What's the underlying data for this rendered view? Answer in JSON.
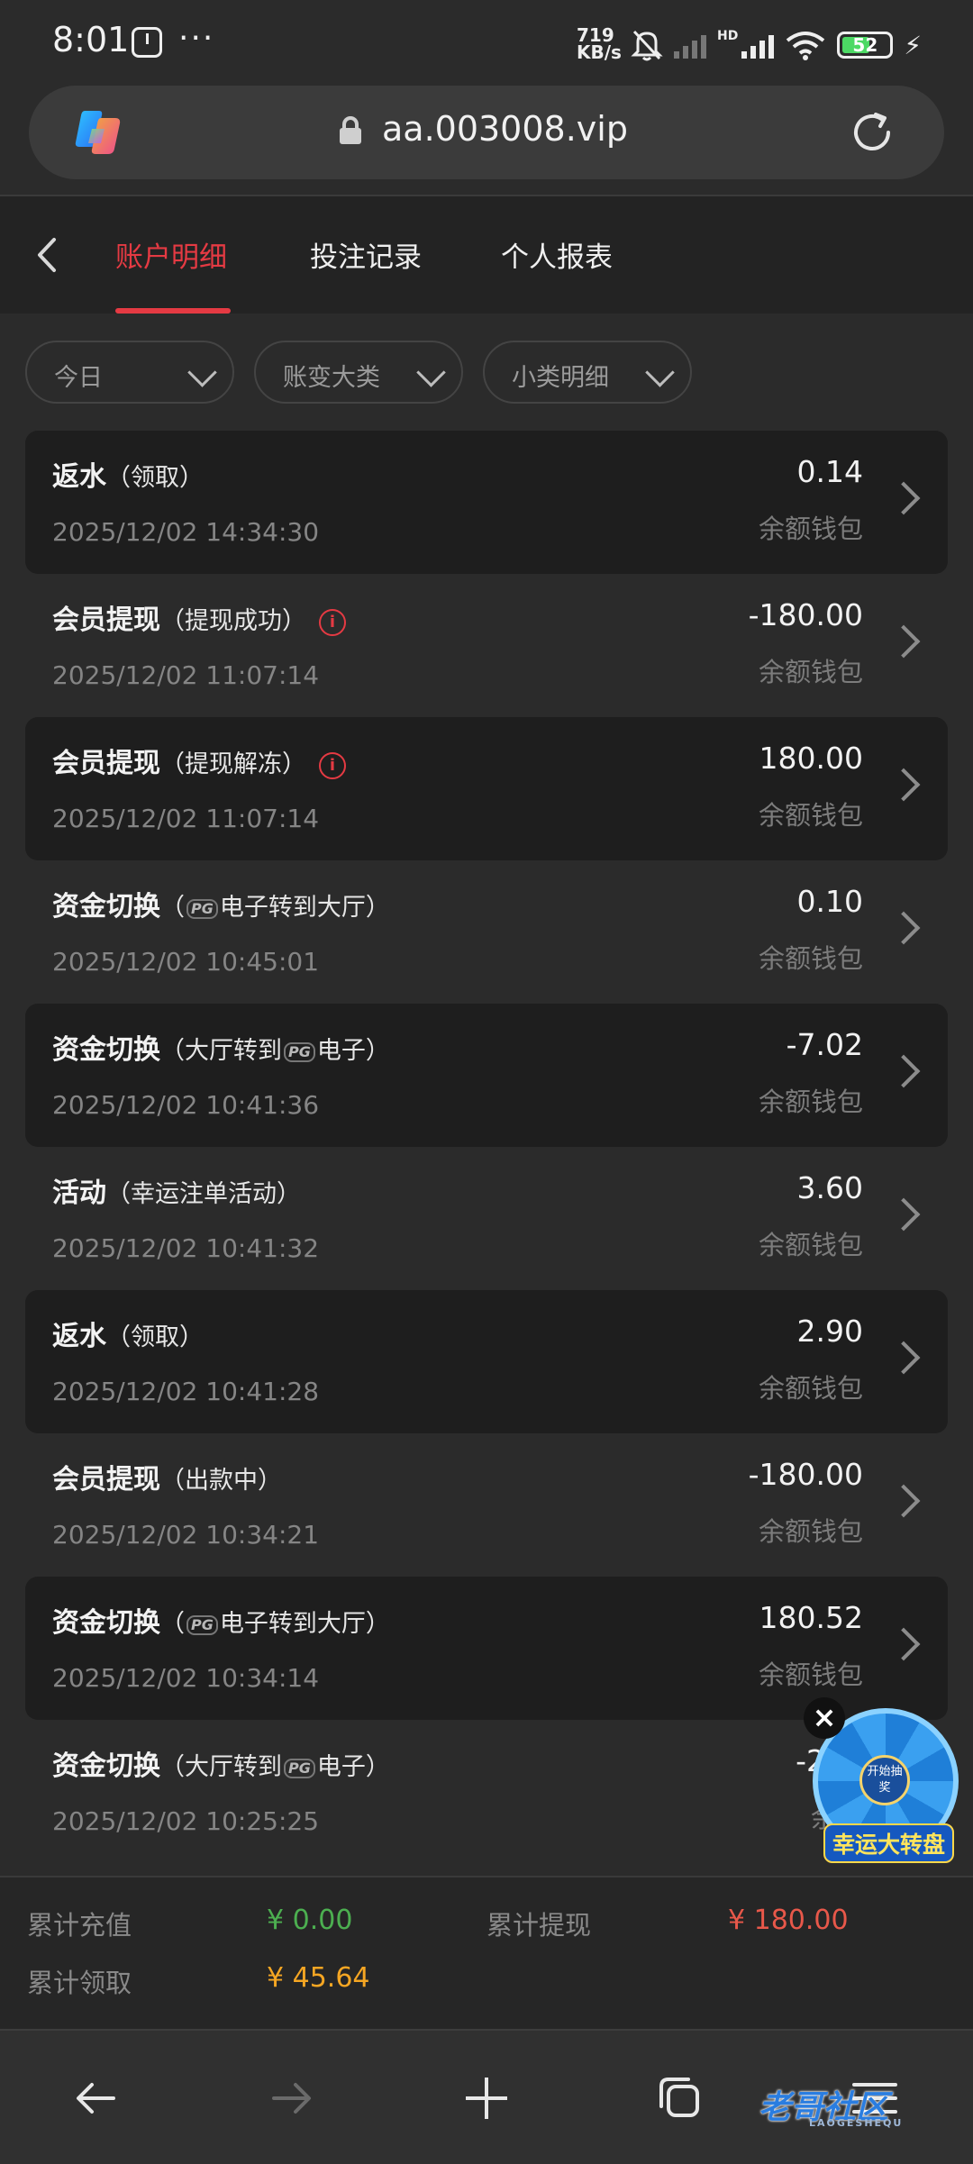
{
  "status_bar": {
    "time": "8:01",
    "speed_value": "719",
    "speed_unit": "KB/s",
    "network_label": "HD",
    "battery_level": "52",
    "icons": [
      "clock-icon",
      "more-dots-icon",
      "mute-bell-icon",
      "signal-off-icon",
      "signal-icon",
      "wifi-icon",
      "battery-icon",
      "charging-bolt-icon"
    ]
  },
  "browser": {
    "url": "aa.003008.vip",
    "icons": [
      "copilot-logo-icon",
      "lock-icon",
      "reload-icon"
    ]
  },
  "tabs": {
    "items": [
      {
        "label": "账户明细",
        "active": true
      },
      {
        "label": "投注记录",
        "active": false
      },
      {
        "label": "个人报表",
        "active": false
      }
    ]
  },
  "filters": [
    {
      "label": "今日"
    },
    {
      "label": "账变大类"
    },
    {
      "label": "小类明细"
    }
  ],
  "transactions": [
    {
      "type": "返水",
      "pre": "（领取）",
      "post": "",
      "info": false,
      "time": "2025/12/02 14:34:30",
      "amount": "0.14",
      "wallet": "余额钱包"
    },
    {
      "type": "会员提现",
      "pre": "（提现成功）",
      "post": "",
      "info": true,
      "time": "2025/12/02 11:07:14",
      "amount": "-180.00",
      "wallet": "余额钱包"
    },
    {
      "type": "会员提现",
      "pre": "（提现解冻）",
      "post": "",
      "info": true,
      "time": "2025/12/02 11:07:14",
      "amount": "180.00",
      "wallet": "余额钱包"
    },
    {
      "type": "资金切换",
      "pre": "（",
      "pg": "PG",
      "post": "电子转到大厅）",
      "info": false,
      "time": "2025/12/02 10:45:01",
      "amount": "0.10",
      "wallet": "余额钱包"
    },
    {
      "type": "资金切换",
      "pre": "（大厅转到",
      "pg": "PG",
      "post": "电子）",
      "info": false,
      "time": "2025/12/02 10:41:36",
      "amount": "-7.02",
      "wallet": "余额钱包"
    },
    {
      "type": "活动",
      "pre": "（幸运注单活动）",
      "post": "",
      "info": false,
      "time": "2025/12/02 10:41:32",
      "amount": "3.60",
      "wallet": "余额钱包"
    },
    {
      "type": "返水",
      "pre": "（领取）",
      "post": "",
      "info": false,
      "time": "2025/12/02 10:41:28",
      "amount": "2.90",
      "wallet": "余额钱包"
    },
    {
      "type": "会员提现",
      "pre": "（出款中）",
      "post": "",
      "info": false,
      "time": "2025/12/02 10:34:21",
      "amount": "-180.00",
      "wallet": "余额钱包"
    },
    {
      "type": "资金切换",
      "pre": "（",
      "pg": "PG",
      "post": "电子转到大厅）",
      "info": false,
      "time": "2025/12/02 10:34:14",
      "amount": "180.52",
      "wallet": "余额钱包"
    },
    {
      "type": "资金切换",
      "pre": "（大厅转到",
      "pg": "PG",
      "post": "电子）",
      "info": false,
      "time": "2025/12/02 10:25:25",
      "amount": "-205",
      "wallet": "余额"
    }
  ],
  "wheel_popup": {
    "center_text": "开始抽奖",
    "label": "幸运大转盘",
    "close": "×"
  },
  "totals": {
    "recharge_label": "累计充值",
    "recharge_value": "¥ 0.00",
    "withdraw_label": "累计提现",
    "withdraw_value": "¥ 180.00",
    "claim_label": "累计领取",
    "claim_value": "¥ 45.64"
  },
  "colors": {
    "accent_red": "#e53a43",
    "green": "#4caf50",
    "orange": "#f5a623",
    "withdraw_red": "#e8584a"
  },
  "bottom_nav": {
    "icons": [
      "back-arrow-icon",
      "forward-arrow-icon",
      "new-tab-plus-icon",
      "tabs-icon",
      "menu-icon"
    ],
    "watermark_text": "老哥社区",
    "watermark_sub": "LAOGESHEQU"
  }
}
